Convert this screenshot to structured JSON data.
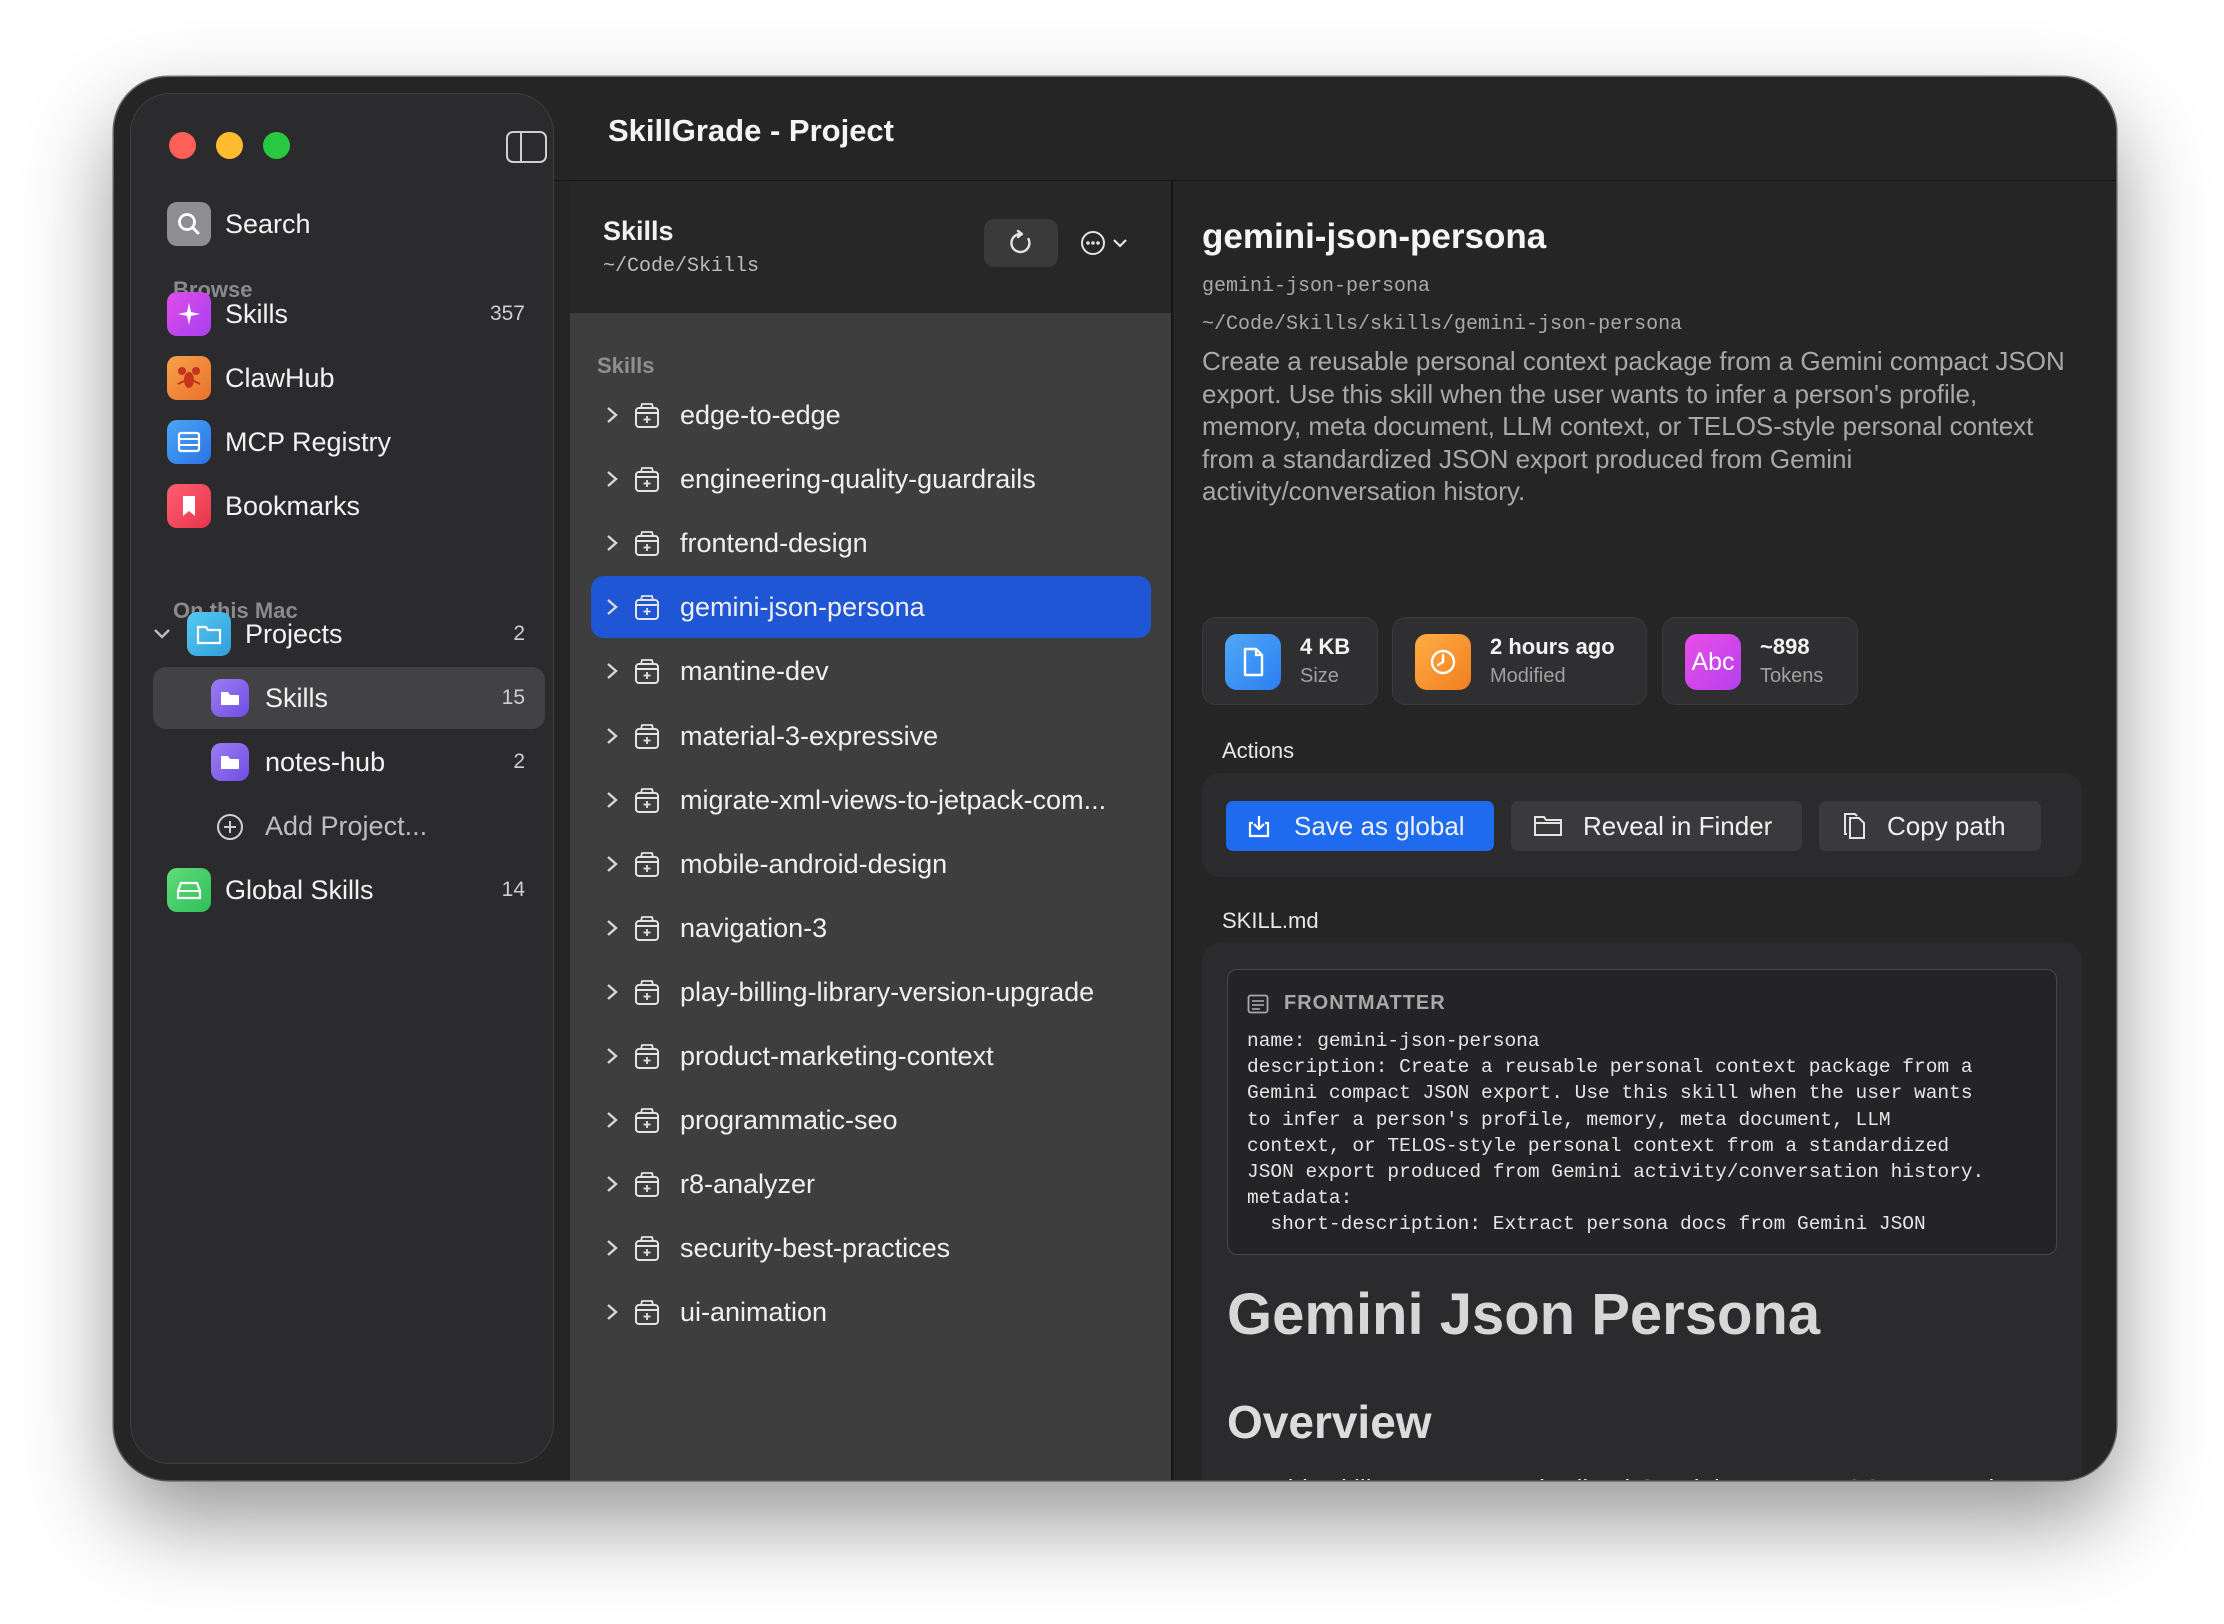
{
  "window": {
    "title": "SkillGrade - Project"
  },
  "colors": {
    "accent": "#1f56d6",
    "primary_button": "#1e6bf0",
    "close": "#fe5f57",
    "minimize": "#febc2e",
    "zoom": "#28c840"
  },
  "sidebar": {
    "search_label": "Search",
    "browse_header": "Browse",
    "browse_items": [
      {
        "label": "Skills",
        "count": "357",
        "icon": "sparkle-icon"
      },
      {
        "label": "ClawHub",
        "count": "",
        "icon": "lobster-icon"
      },
      {
        "label": "MCP Registry",
        "count": "",
        "icon": "server-icon"
      },
      {
        "label": "Bookmarks",
        "count": "",
        "icon": "bookmark-icon"
      }
    ],
    "mac_header": "On this Mac",
    "projects": {
      "label": "Projects",
      "count": "2"
    },
    "project_items": [
      {
        "label": "Skills",
        "count": "15"
      },
      {
        "label": "notes-hub",
        "count": "2"
      }
    ],
    "add_project": "Add Project...",
    "global_skills": {
      "label": "Global Skills",
      "count": "14"
    }
  },
  "list": {
    "title": "Skills",
    "path": "~/Code/Skills",
    "section_header": "Skills",
    "items": [
      "edge-to-edge",
      "engineering-quality-guardrails",
      "frontend-design",
      "gemini-json-persona",
      "mantine-dev",
      "material-3-expressive",
      "migrate-xml-views-to-jetpack-com...",
      "mobile-android-design",
      "navigation-3",
      "play-billing-library-version-upgrade",
      "product-marketing-context",
      "programmatic-seo",
      "r8-analyzer",
      "security-best-practices",
      "ui-animation"
    ],
    "selected_index": 3
  },
  "detail": {
    "title": "gemini-json-persona",
    "id": "gemini-json-persona",
    "path": "~/Code/Skills/skills/gemini-json-persona",
    "description": "Create a reusable personal context package from a Gemini compact JSON export. Use this skill when the user wants to infer a person's profile, memory, meta document, LLM context, or TELOS-style personal context from a standardized JSON export produced from Gemini activity/conversation history.",
    "stats": [
      {
        "value": "4 KB",
        "label": "Size"
      },
      {
        "value": "2 hours ago",
        "label": "Modified"
      },
      {
        "value": "~898",
        "label": "Tokens",
        "icon_text": "Abc"
      }
    ],
    "actions_header": "Actions",
    "actions": {
      "save": "Save as global",
      "reveal": "Reveal in Finder",
      "copy": "Copy path"
    },
    "file_header": "SKILL.md",
    "frontmatter_header": "FRONTMATTER",
    "frontmatter": "name: gemini-json-persona\ndescription: Create a reusable personal context package from a\nGemini compact JSON export. Use this skill when the user wants\nto infer a person's profile, memory, meta document, LLM\ncontext, or TELOS-style personal context from a standardized\nJSON export produced from Gemini activity/conversation history.\nmetadata:\n  short-description: Extract persona docs from Gemini JSON",
    "md_title": "Gemini Json Persona",
    "md_h2": "Overview",
    "md_paragraph": "Use this skill to turn a standardized Gemini compact JSON export into three reusable artifacts:"
  }
}
